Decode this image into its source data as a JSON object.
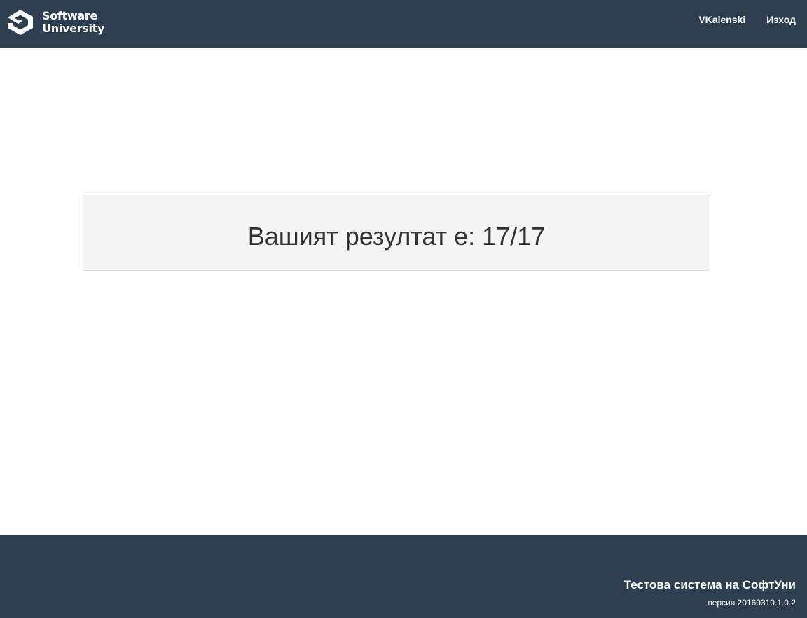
{
  "header": {
    "brand_line1": "Software",
    "brand_line2": "University",
    "brand_icon": "softuni-logo-icon",
    "user_link": "VKalenski",
    "logout_link": "Изход"
  },
  "main": {
    "result_text": "Вашият резултат е: 17/17"
  },
  "footer": {
    "title": "Тестова система на СофтУни",
    "version": "версия 20160310.1.0.2"
  },
  "colors": {
    "header_bg": "#2d3e50",
    "footer_bg": "#2d3e50",
    "result_box_bg": "#f4f4f4",
    "text_dark": "#333333"
  }
}
